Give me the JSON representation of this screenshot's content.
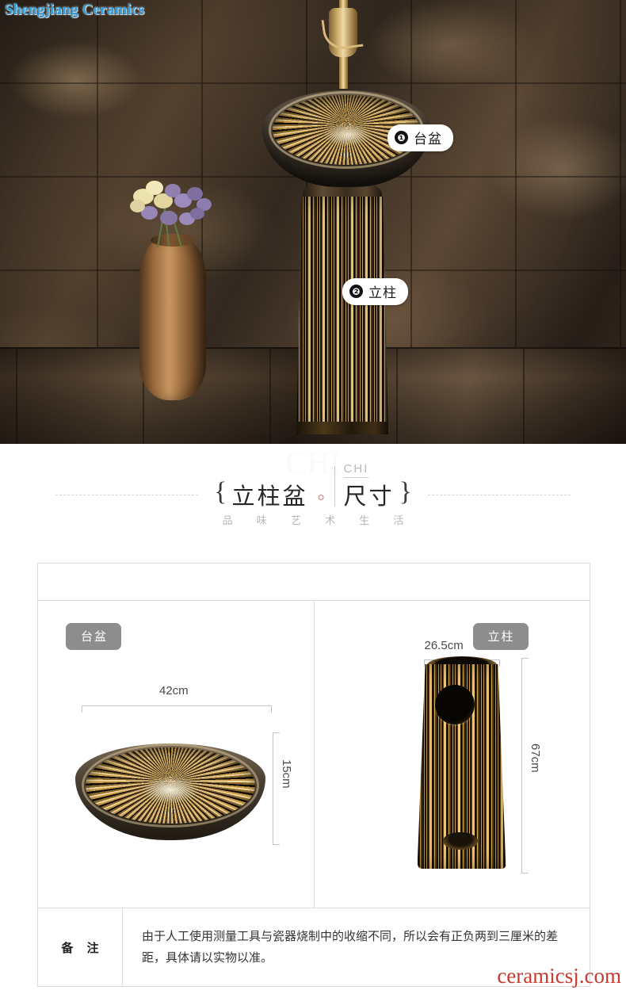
{
  "brand": {
    "name": "Shengjiang Ceramics"
  },
  "hero": {
    "callouts": [
      {
        "number": "❶",
        "label": "台盆",
        "name": "basin"
      },
      {
        "number": "❷",
        "label": "立柱",
        "name": "pillar"
      }
    ]
  },
  "section_title": {
    "brace_left": "{",
    "brace_right": "}",
    "main": "立柱盆",
    "separator_dot": "○",
    "second": "尺寸",
    "pinyin_tag": "CHI",
    "subtitle": "品 味 艺 术 生 活",
    "watermark": "CHI"
  },
  "spec_table": {
    "header_row": "",
    "products": [
      {
        "badge": "台盆",
        "width_label": "42cm",
        "height_label": "15cm"
      },
      {
        "badge": "立柱",
        "width_label": "26.5cm",
        "height_label": "67cm"
      }
    ],
    "note": {
      "label": "备 注",
      "text": "由于人工使用测量工具与瓷器烧制中的收缩不同，所以会有正负两到三厘米的差距，具体请以实物以准。"
    }
  },
  "watermark": {
    "site": "ceramicsj.com"
  },
  "colors": {
    "brand_blue": "#2f9fe0",
    "badge_gray": "#8d8d8d",
    "accent_red": "#b02a34",
    "watermark_red": "#c8392f",
    "table_border": "#dcdcdc"
  }
}
